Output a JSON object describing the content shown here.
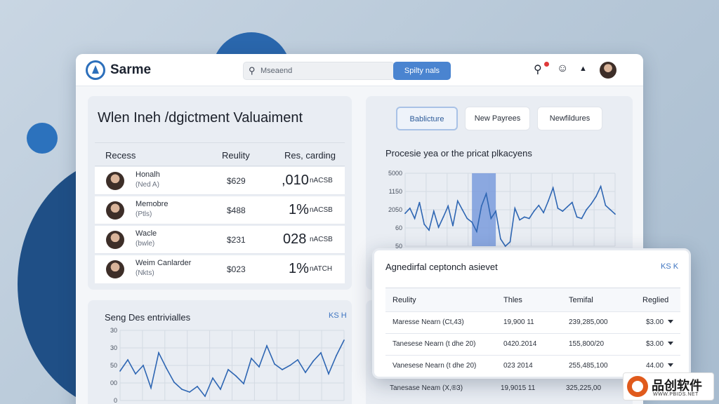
{
  "app": {
    "brand": "Sarme"
  },
  "search": {
    "placeholder": "Mseaend"
  },
  "toolbar": {
    "apply_label": "Spilty nals",
    "notification_icon": "search-bell-icon",
    "user_icon": "user-icon",
    "menu_icon": "caret-icon"
  },
  "panel_valuation": {
    "title": "Wlen Ineh /dgictment Valuaiment",
    "headers": [
      "Recess",
      "Reulity",
      "Res, carding"
    ],
    "rows": [
      {
        "name": "Honalh",
        "sub": "(Ned A)",
        "price": "$629",
        "big": ",010",
        "tag": "nACSB"
      },
      {
        "name": "Memobre",
        "sub": "(Ptls)",
        "price": "$488",
        "big": "1%",
        "tag": "nACSB"
      },
      {
        "name": "Wacle",
        "sub": "(bwle)",
        "price": "$231",
        "big": "028",
        "tag": "nACSB"
      },
      {
        "name": "Weim Canlarder",
        "sub": "(Nkts)",
        "price": "$023",
        "big": "1%",
        "tag": "nATCH"
      }
    ]
  },
  "panel_chart": {
    "tabs": [
      "Bablicture",
      "New Payrees",
      "Newfildures"
    ],
    "active_tab": 0,
    "title": "Procesie yea or the pricat plkacyens"
  },
  "panel_series": {
    "title": "Seng Des entrivialles",
    "link": "KS H"
  },
  "overlay": {
    "title": "Agnedirfal ceptonch asievet",
    "link": "KS K",
    "headers": [
      "Reulity",
      "Thles",
      "Temifal",
      "Reglied"
    ],
    "rows": [
      [
        "Maresse Nearn (Ct,43)",
        "19,900 11",
        "239,285,000",
        "$3.00"
      ],
      [
        "Tanesese Nearn (t dhe 20)",
        "0420.2014",
        "155,800/20",
        "$3.00"
      ],
      [
        "Vanesese Nearn (t dhe 20)",
        "023 2014",
        "255,485,100",
        "44.00"
      ]
    ]
  },
  "peek_row": [
    "Tanesase Neam (X,®3)",
    "19,9015 11",
    "325,225,00"
  ],
  "watermark": {
    "text": "品创软件",
    "url": "WWW.PBIDS.NET"
  },
  "chart_data": [
    {
      "type": "line",
      "title": "Procesie yea or the pricat plkacyens",
      "y_ticks": [
        "5000",
        "1150",
        "2050",
        "60",
        "50"
      ],
      "ylim": [
        0,
        100
      ],
      "x": [
        0,
        1,
        2,
        3,
        4,
        5,
        6,
        7,
        8,
        9,
        10,
        11,
        12,
        13,
        14,
        15,
        16,
        17,
        18,
        19,
        20,
        21,
        22,
        23,
        24,
        25,
        26,
        27,
        28,
        29,
        30,
        31,
        32,
        33,
        34,
        35,
        36,
        37,
        38,
        39,
        40,
        41,
        42,
        43,
        44
      ],
      "values": [
        45,
        52,
        38,
        60,
        30,
        22,
        48,
        26,
        40,
        55,
        28,
        62,
        50,
        38,
        33,
        20,
        55,
        72,
        38,
        48,
        10,
        0,
        6,
        52,
        36,
        40,
        38,
        48,
        56,
        46,
        62,
        80,
        52,
        48,
        54,
        60,
        40,
        38,
        50,
        58,
        68,
        82,
        56,
        50,
        44
      ],
      "highlight_range": [
        14,
        19
      ],
      "grid": true
    },
    {
      "type": "line",
      "title": "Seng Des entrivialles",
      "y_ticks": [
        "30",
        "30",
        "50",
        "00",
        "0"
      ],
      "ylim": [
        0,
        100
      ],
      "x": [
        0,
        1,
        2,
        3,
        4,
        5,
        6,
        7,
        8,
        9,
        10,
        11,
        12,
        13,
        14,
        15,
        16,
        17,
        18,
        19,
        20,
        21,
        22,
        23,
        24,
        25,
        26,
        27,
        28,
        29
      ],
      "values": [
        42,
        58,
        38,
        50,
        18,
        68,
        46,
        26,
        16,
        12,
        20,
        6,
        32,
        16,
        44,
        35,
        24,
        60,
        48,
        78,
        52,
        44,
        50,
        58,
        40,
        56,
        68,
        38,
        64,
        86
      ],
      "grid": true
    }
  ]
}
